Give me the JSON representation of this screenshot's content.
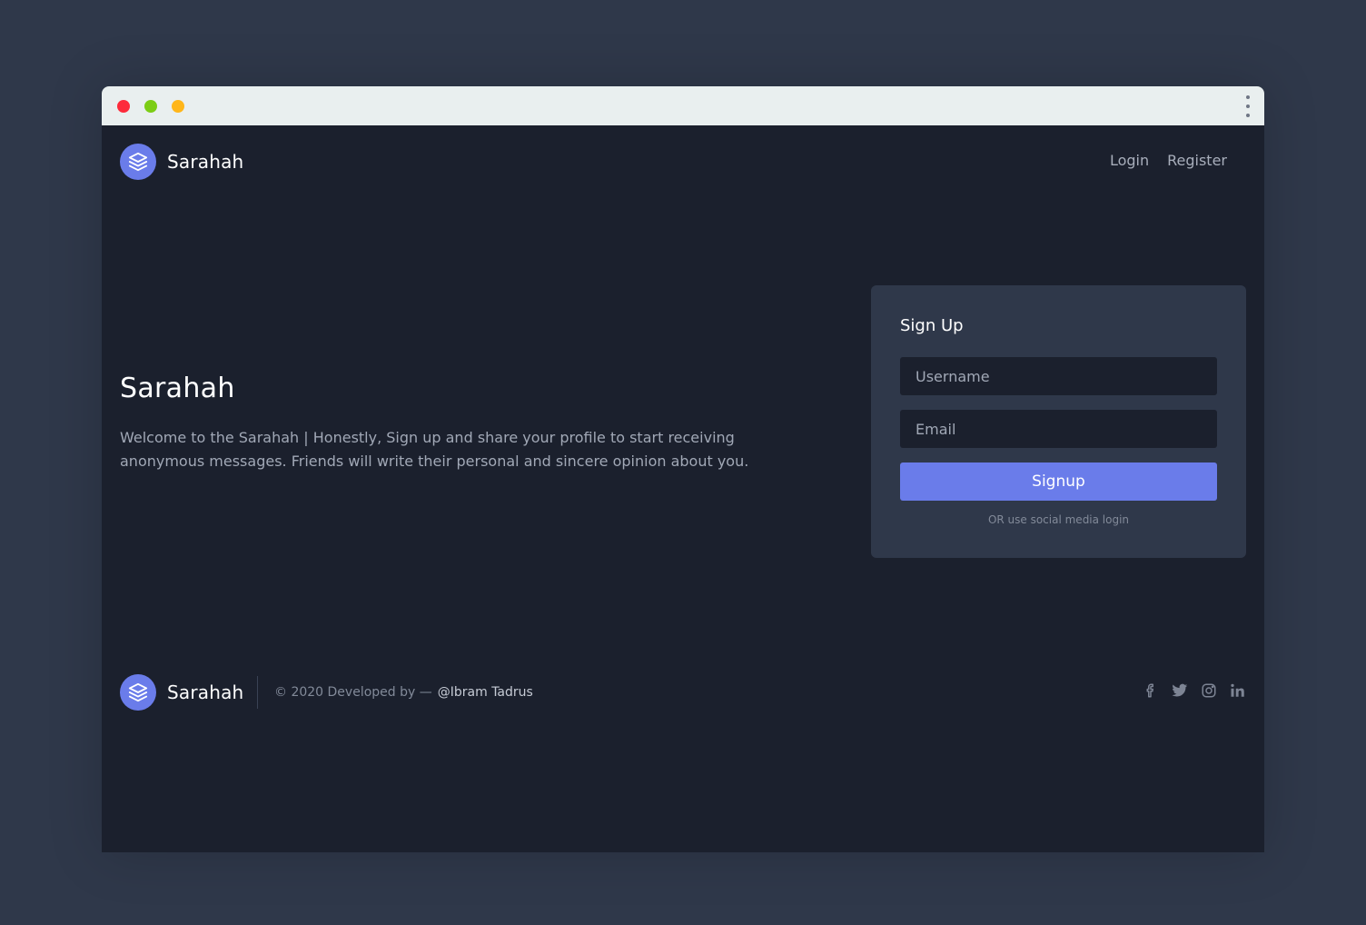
{
  "window": {
    "controls": [
      "close",
      "minimize",
      "maximize"
    ],
    "menu_icon": "more-vertical-icon"
  },
  "navbar": {
    "brand": "Sarahah",
    "logo_icon": "layers-icon",
    "links": {
      "login": "Login",
      "register": "Register"
    }
  },
  "hero": {
    "title": "Sarahah",
    "description": "Welcome to the Sarahah | Honestly, Sign up and share your profile to start receiving anonymous messages. Friends will write their personal and sincere opinion about you."
  },
  "signup_card": {
    "title": "Sign Up",
    "username_placeholder": "Username",
    "email_placeholder": "Email",
    "button_label": "Signup",
    "social_note": "OR use social media login"
  },
  "footer": {
    "brand": "Sarahah",
    "copyright": "© 2020 Developed by —",
    "author": "@Ibram Tadrus",
    "socials": [
      "facebook-icon",
      "twitter-icon",
      "instagram-icon",
      "linkedin-icon"
    ]
  },
  "colors": {
    "page_bg": "#2f384a",
    "app_bg": "#1b202d",
    "card_bg": "#2f384a",
    "accent": "#6a7cea",
    "titlebar": "#e9efef",
    "close": "#fd2b3b",
    "minimize": "#7ccd15",
    "maximize": "#ffb61a"
  }
}
